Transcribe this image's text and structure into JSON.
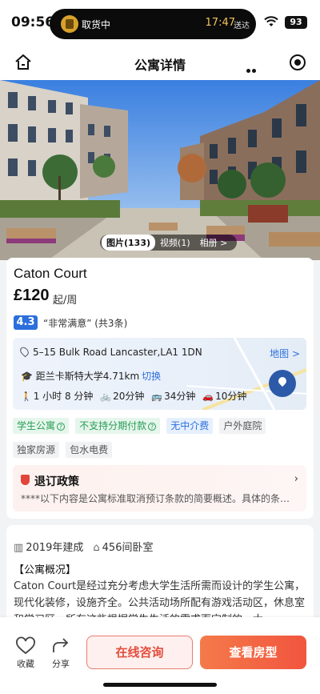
{
  "status_bar": {
    "time": "09:56",
    "live_activity": {
      "status": "取货中",
      "eta": "17:47",
      "eta_suffix": "送达"
    },
    "battery": "93"
  },
  "nav": {
    "title": "公寓详情"
  },
  "hero": {
    "media_tabs": [
      {
        "label": "图片(133)",
        "active": true
      },
      {
        "label": "视频(1)",
        "active": false
      },
      {
        "label": "相册 >",
        "active": false
      }
    ]
  },
  "property": {
    "name": "Caton Court",
    "price": "£120",
    "price_unit": "起/周",
    "rating_score": "4.3",
    "rating_text": "“非常满意” (共3条)",
    "address": "5–15 Bulk Road Lancaster,LA1 1DN",
    "map_link": "地图 >",
    "university": "距兰卡斯特大学4.71km",
    "university_switch": "切换",
    "transport": [
      {
        "icon": "walk-icon",
        "glyph": "🚶",
        "text": "1 小时 8 分钟"
      },
      {
        "icon": "bike-icon",
        "glyph": "🚲",
        "text": "20分钟"
      },
      {
        "icon": "bus-icon",
        "glyph": "🚌",
        "text": "34分钟"
      },
      {
        "icon": "car-icon",
        "glyph": "🚗",
        "text": "10分钟"
      }
    ],
    "tags": [
      {
        "label": "学生公寓",
        "style": "green",
        "help": true
      },
      {
        "label": "不支持分期付款",
        "style": "green",
        "help": true
      },
      {
        "label": "无中介费",
        "style": "blue",
        "help": false
      },
      {
        "label": "户外庭院",
        "style": "grey",
        "help": false
      },
      {
        "label": "独家房源",
        "style": "grey",
        "help": false
      },
      {
        "label": "包水电费",
        "style": "grey",
        "help": false
      }
    ],
    "policy_title": "退订政策",
    "policy_desc": "****以下内容是公寓标准取消预订条款的简要概述。具体的条…"
  },
  "details": {
    "year_built": "2019年建成",
    "bedrooms": "456间卧室",
    "section_title": "【公寓概况】",
    "description": "Caton Court是经过充分考虑大学生活所需而设计的学生公寓，现代化装修，设施齐全。公共活动场所配有游戏活动区，休息室和学习区，所有这些根据学生生活的需求而定制的，大"
  },
  "bottom_bar": {
    "favorite_label": "收藏",
    "share_label": "分享",
    "consult_label": "在线咨询",
    "rooms_label": "查看房型"
  },
  "colors": {
    "accent_blue": "#2c6fdc",
    "accent_red": "#e44d3d",
    "accent_orange": "#f2553e"
  }
}
